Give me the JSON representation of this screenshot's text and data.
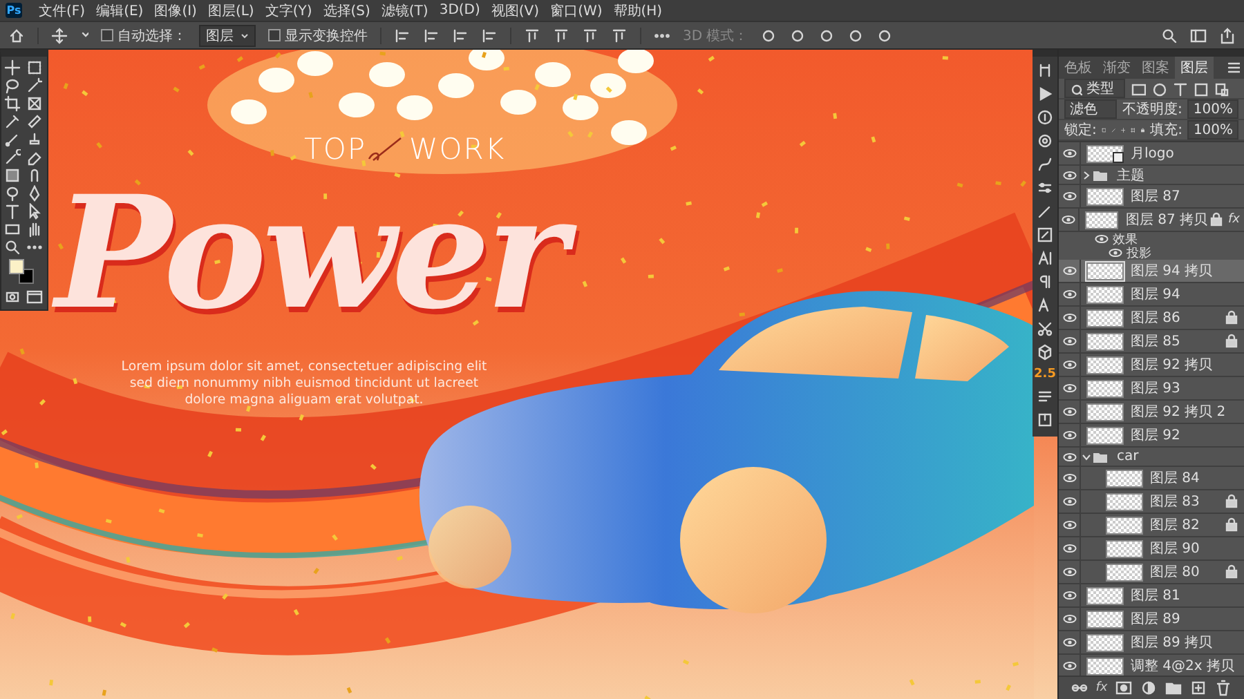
{
  "app_logo": "Ps",
  "menu": [
    "文件(F)",
    "编辑(E)",
    "图像(I)",
    "图层(L)",
    "文字(Y)",
    "选择(S)",
    "滤镜(T)",
    "3D(D)",
    "视图(V)",
    "窗口(W)",
    "帮助(H)"
  ],
  "options_bar": {
    "auto_select": {
      "label": "自动选择：",
      "checked": false
    },
    "auto_select_target": "图层",
    "show_transform": {
      "label": "显示变换控件",
      "checked": false
    },
    "mode_3d_label": "3D 模式："
  },
  "canvas": {
    "headline": "Power",
    "tagline_left": "TOP",
    "tagline_right": "WORK",
    "body_lines": [
      "Lorem ipsum dolor sit amet, consectetuer adipiscing elit",
      "sed diem nonummy nibh euismod tincidunt ut lacreet",
      "dolore magna aliguam erat volutpat."
    ]
  },
  "dock": {
    "badge": "2.5"
  },
  "panel": {
    "tabs": [
      {
        "label": "色板",
        "selected": false
      },
      {
        "label": "渐变",
        "selected": false
      },
      {
        "label": "图案",
        "selected": false
      },
      {
        "label": "图层",
        "selected": true
      }
    ],
    "filter_kind": "类型",
    "blend_mode": "滤色",
    "opacity_label": "不透明度:",
    "opacity": "100%",
    "lock_label": "锁定:",
    "fill_label": "填充:",
    "fill": "100%",
    "footer_fx": "fx",
    "layers": [
      {
        "name": "月logo",
        "kind": "smart",
        "visible": true,
        "selected": false,
        "locked": false
      },
      {
        "name": "主题",
        "kind": "group",
        "visible": true,
        "selected": false,
        "expanded": false
      },
      {
        "name": "图层 87",
        "kind": "layer",
        "visible": true,
        "selected": false,
        "locked": false
      },
      {
        "name": "图层 87 拷贝",
        "kind": "layer",
        "visible": true,
        "selected": false,
        "locked": true,
        "badge": "fx",
        "effects": {
          "label": "效果",
          "visible": true,
          "items": [
            {
              "name": "投影",
              "visible": true
            }
          ]
        }
      },
      {
        "name": "图层 94 拷贝",
        "kind": "layer",
        "visible": true,
        "selected": true,
        "locked": false
      },
      {
        "name": "图层 94",
        "kind": "layer",
        "visible": true,
        "selected": false,
        "locked": false
      },
      {
        "name": "图层 86",
        "kind": "layer",
        "visible": true,
        "selected": false,
        "locked": true
      },
      {
        "name": "图层 85",
        "kind": "layer",
        "visible": true,
        "selected": false,
        "locked": true
      },
      {
        "name": "图层 92 拷贝",
        "kind": "layer",
        "visible": true,
        "selected": false,
        "locked": false
      },
      {
        "name": "图层 93",
        "kind": "layer",
        "visible": true,
        "selected": false,
        "locked": false
      },
      {
        "name": "图层 92 拷贝 2",
        "kind": "layer",
        "visible": true,
        "selected": false,
        "locked": false
      },
      {
        "name": "图层 92",
        "kind": "layer",
        "visible": true,
        "selected": false,
        "locked": false
      },
      {
        "name": "car",
        "kind": "group",
        "visible": true,
        "selected": false,
        "expanded": true,
        "children": [
          {
            "name": "图层 84",
            "kind": "layer",
            "visible": true,
            "selected": false,
            "locked": false
          },
          {
            "name": "图层 83",
            "kind": "layer",
            "visible": true,
            "selected": false,
            "locked": true
          },
          {
            "name": "图层 82",
            "kind": "layer",
            "visible": true,
            "selected": false,
            "locked": true
          },
          {
            "name": "图层 90",
            "kind": "layer",
            "visible": true,
            "selected": false,
            "locked": false
          },
          {
            "name": "图层 80",
            "kind": "layer",
            "visible": true,
            "selected": false,
            "locked": true
          }
        ]
      },
      {
        "name": "图层 81",
        "kind": "layer",
        "visible": true,
        "selected": false,
        "locked": false
      },
      {
        "name": "图层 89",
        "kind": "layer",
        "visible": true,
        "selected": false,
        "locked": false
      },
      {
        "name": "图层 89 拷贝",
        "kind": "layer",
        "visible": true,
        "selected": false,
        "locked": false
      },
      {
        "name": "调整 4@2x 拷贝",
        "kind": "layer",
        "visible": true,
        "selected": false,
        "locked": false
      }
    ]
  }
}
